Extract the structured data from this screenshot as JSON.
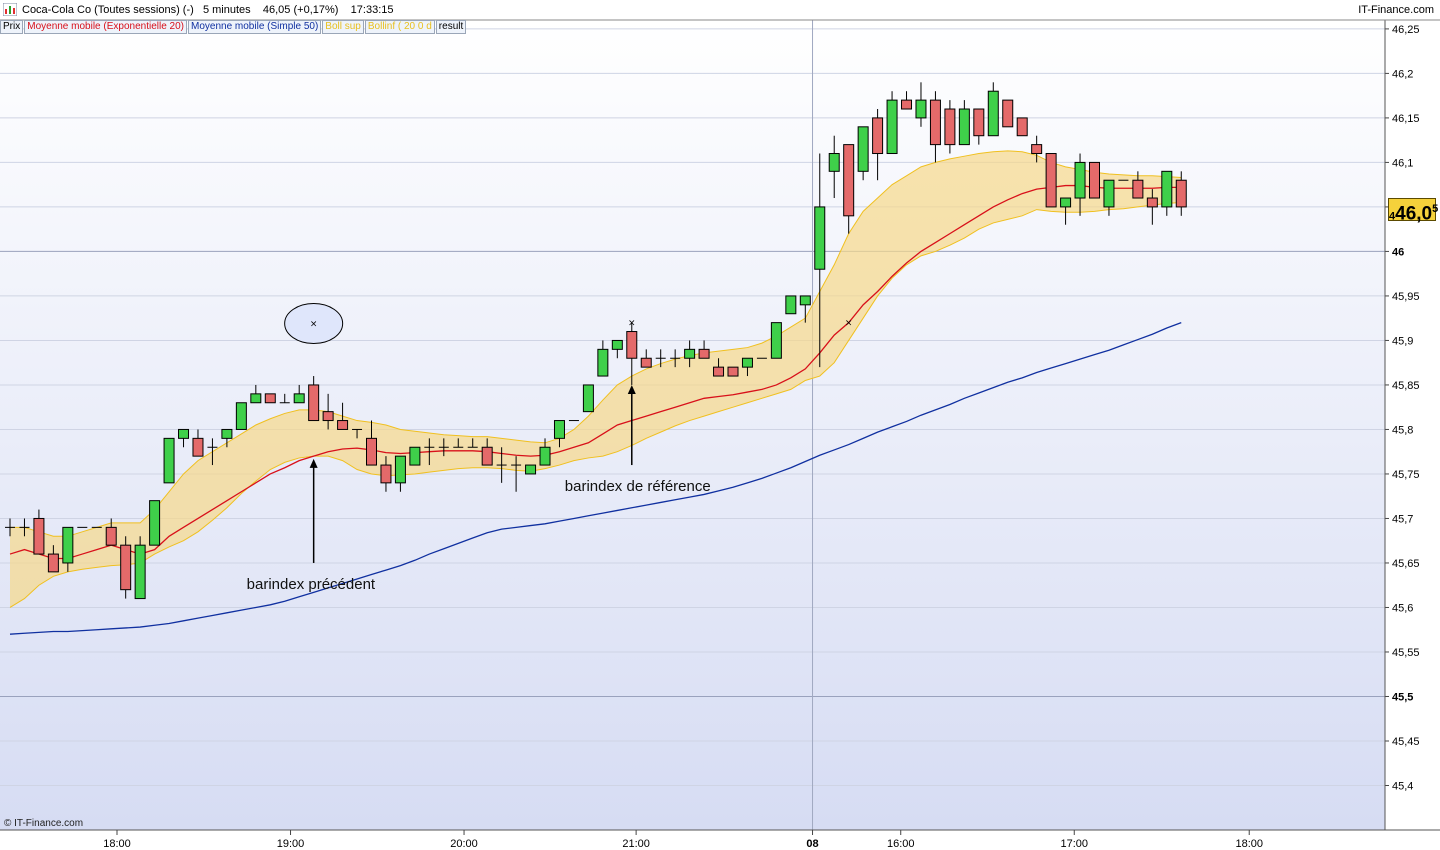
{
  "header": {
    "title": "Coca-Cola Co (Toutes sessions) (-)",
    "interval": "5 minutes",
    "last": "46,05",
    "change": "(+0,17%)",
    "time": "17:33:15",
    "brand": "IT-Finance.com"
  },
  "legend": [
    {
      "label": "Prix",
      "color": "#000000"
    },
    {
      "label": "Moyenne mobile (Exponentielle 20)",
      "color": "#d8101a"
    },
    {
      "label": "Moyenne mobile (Simple 50)",
      "color": "#1030a0"
    },
    {
      "label": "Boll sup",
      "color": "#e8c020"
    },
    {
      "label": "Bollinf ( 20 0 d",
      "color": "#e8c020"
    },
    {
      "label": "result",
      "color": "#000000"
    }
  ],
  "price_badge": {
    "main": "46,0",
    "sup": "5",
    "prefix": "4"
  },
  "footer": "© IT-Finance.com",
  "chart_data": {
    "type": "candlestick",
    "ylim": [
      45.35,
      46.26
    ],
    "y_ticks": [
      "45,4",
      "45,45",
      "45,5",
      "45,55",
      "45,6",
      "45,65",
      "45,7",
      "45,75",
      "45,8",
      "45,85",
      "45,9",
      "45,95",
      "46",
      "46,05",
      "46,1",
      "46,15",
      "46,2",
      "46,25"
    ],
    "y_tick_values": [
      45.4,
      45.45,
      45.5,
      45.55,
      45.6,
      45.65,
      45.7,
      45.75,
      45.8,
      45.85,
      45.9,
      45.95,
      46.0,
      46.05,
      46.1,
      46.15,
      46.2,
      46.25
    ],
    "y_bold_ticks": [
      "45,5",
      "46"
    ],
    "x_ticks": [
      {
        "label": "18:00",
        "bar": 7.4
      },
      {
        "label": "19:00",
        "bar": 19.4
      },
      {
        "label": "20:00",
        "bar": 31.4
      },
      {
        "label": "21:00",
        "bar": 43.3
      },
      {
        "label": "08",
        "bar": 55.5,
        "bold": true
      },
      {
        "label": "16:00",
        "bar": 61.6
      },
      {
        "label": "17:00",
        "bar": 73.6
      },
      {
        "label": "18:00",
        "bar": 85.7
      }
    ],
    "session_break_bar": 55.5,
    "bars": [
      {
        "o": 45.69,
        "h": 45.7,
        "l": 45.68,
        "c": 45.69
      },
      {
        "o": 45.69,
        "h": 45.7,
        "l": 45.68,
        "c": 45.69
      },
      {
        "o": 45.7,
        "h": 45.71,
        "l": 45.66,
        "c": 45.66
      },
      {
        "o": 45.66,
        "h": 45.67,
        "l": 45.64,
        "c": 45.64
      },
      {
        "o": 45.65,
        "h": 45.69,
        "l": 45.64,
        "c": 45.69
      },
      {
        "o": 45.69,
        "h": 45.69,
        "l": 45.69,
        "c": 45.69
      },
      {
        "o": 45.69,
        "h": 45.69,
        "l": 45.69,
        "c": 45.69
      },
      {
        "o": 45.69,
        "h": 45.7,
        "l": 45.67,
        "c": 45.67
      },
      {
        "o": 45.67,
        "h": 45.68,
        "l": 45.61,
        "c": 45.62
      },
      {
        "o": 45.61,
        "h": 45.68,
        "l": 45.61,
        "c": 45.67
      },
      {
        "o": 45.67,
        "h": 45.72,
        "l": 45.67,
        "c": 45.72
      },
      {
        "o": 45.74,
        "h": 45.79,
        "l": 45.74,
        "c": 45.79
      },
      {
        "o": 45.79,
        "h": 45.8,
        "l": 45.78,
        "c": 45.8
      },
      {
        "o": 45.79,
        "h": 45.8,
        "l": 45.77,
        "c": 45.77
      },
      {
        "o": 45.78,
        "h": 45.79,
        "l": 45.76,
        "c": 45.78
      },
      {
        "o": 45.79,
        "h": 45.8,
        "l": 45.78,
        "c": 45.8
      },
      {
        "o": 45.8,
        "h": 45.83,
        "l": 45.8,
        "c": 45.83
      },
      {
        "o": 45.83,
        "h": 45.85,
        "l": 45.83,
        "c": 45.84
      },
      {
        "o": 45.84,
        "h": 45.84,
        "l": 45.83,
        "c": 45.83
      },
      {
        "o": 45.83,
        "h": 45.84,
        "l": 45.83,
        "c": 45.83
      },
      {
        "o": 45.83,
        "h": 45.85,
        "l": 45.83,
        "c": 45.84
      },
      {
        "o": 45.85,
        "h": 45.86,
        "l": 45.81,
        "c": 45.81
      },
      {
        "o": 45.82,
        "h": 45.84,
        "l": 45.8,
        "c": 45.81
      },
      {
        "o": 45.81,
        "h": 45.83,
        "l": 45.8,
        "c": 45.8
      },
      {
        "o": 45.8,
        "h": 45.8,
        "l": 45.79,
        "c": 45.8
      },
      {
        "o": 45.79,
        "h": 45.81,
        "l": 45.76,
        "c": 45.76
      },
      {
        "o": 45.76,
        "h": 45.77,
        "l": 45.73,
        "c": 45.74
      },
      {
        "o": 45.74,
        "h": 45.77,
        "l": 45.73,
        "c": 45.77
      },
      {
        "o": 45.76,
        "h": 45.78,
        "l": 45.76,
        "c": 45.78
      },
      {
        "o": 45.78,
        "h": 45.79,
        "l": 45.76,
        "c": 45.78
      },
      {
        "o": 45.78,
        "h": 45.79,
        "l": 45.77,
        "c": 45.78
      },
      {
        "o": 45.78,
        "h": 45.79,
        "l": 45.78,
        "c": 45.78
      },
      {
        "o": 45.78,
        "h": 45.79,
        "l": 45.78,
        "c": 45.78
      },
      {
        "o": 45.78,
        "h": 45.79,
        "l": 45.77,
        "c": 45.76
      },
      {
        "o": 45.76,
        "h": 45.78,
        "l": 45.74,
        "c": 45.76
      },
      {
        "o": 45.76,
        "h": 45.77,
        "l": 45.73,
        "c": 45.76
      },
      {
        "o": 45.75,
        "h": 45.76,
        "l": 45.75,
        "c": 45.76
      },
      {
        "o": 45.76,
        "h": 45.79,
        "l": 45.76,
        "c": 45.78
      },
      {
        "o": 45.79,
        "h": 45.81,
        "l": 45.78,
        "c": 45.81
      },
      {
        "o": 45.81,
        "h": 45.81,
        "l": 45.81,
        "c": 45.81
      },
      {
        "o": 45.82,
        "h": 45.85,
        "l": 45.82,
        "c": 45.85
      },
      {
        "o": 45.86,
        "h": 45.9,
        "l": 45.86,
        "c": 45.89
      },
      {
        "o": 45.89,
        "h": 45.9,
        "l": 45.88,
        "c": 45.9
      },
      {
        "o": 45.91,
        "h": 45.92,
        "l": 45.85,
        "c": 45.88
      },
      {
        "o": 45.88,
        "h": 45.89,
        "l": 45.87,
        "c": 45.87
      },
      {
        "o": 45.88,
        "h": 45.89,
        "l": 45.87,
        "c": 45.88
      },
      {
        "o": 45.88,
        "h": 45.89,
        "l": 45.87,
        "c": 45.88
      },
      {
        "o": 45.88,
        "h": 45.9,
        "l": 45.87,
        "c": 45.89
      },
      {
        "o": 45.89,
        "h": 45.9,
        "l": 45.88,
        "c": 45.88
      },
      {
        "o": 45.87,
        "h": 45.88,
        "l": 45.86,
        "c": 45.86
      },
      {
        "o": 45.87,
        "h": 45.87,
        "l": 45.86,
        "c": 45.86
      },
      {
        "o": 45.87,
        "h": 45.88,
        "l": 45.86,
        "c": 45.88
      },
      {
        "o": 45.88,
        "h": 45.88,
        "l": 45.88,
        "c": 45.88
      },
      {
        "o": 45.88,
        "h": 45.92,
        "l": 45.88,
        "c": 45.92
      },
      {
        "o": 45.93,
        "h": 45.95,
        "l": 45.93,
        "c": 45.95
      },
      {
        "o": 45.94,
        "h": 45.95,
        "l": 45.92,
        "c": 45.95
      },
      {
        "o": 45.98,
        "h": 46.11,
        "l": 45.87,
        "c": 46.05
      },
      {
        "o": 46.09,
        "h": 46.13,
        "l": 46.06,
        "c": 46.11
      },
      {
        "o": 46.12,
        "h": 46.12,
        "l": 46.02,
        "c": 46.04
      },
      {
        "o": 46.09,
        "h": 46.14,
        "l": 46.08,
        "c": 46.14
      },
      {
        "o": 46.15,
        "h": 46.16,
        "l": 46.08,
        "c": 46.11
      },
      {
        "o": 46.11,
        "h": 46.18,
        "l": 46.11,
        "c": 46.17
      },
      {
        "o": 46.17,
        "h": 46.18,
        "l": 46.16,
        "c": 46.16
      },
      {
        "o": 46.15,
        "h": 46.19,
        "l": 46.14,
        "c": 46.17
      },
      {
        "o": 46.17,
        "h": 46.18,
        "l": 46.1,
        "c": 46.12
      },
      {
        "o": 46.16,
        "h": 46.17,
        "l": 46.11,
        "c": 46.12
      },
      {
        "o": 46.12,
        "h": 46.17,
        "l": 46.12,
        "c": 46.16
      },
      {
        "o": 46.16,
        "h": 46.16,
        "l": 46.12,
        "c": 46.13
      },
      {
        "o": 46.13,
        "h": 46.19,
        "l": 46.13,
        "c": 46.18
      },
      {
        "o": 46.17,
        "h": 46.17,
        "l": 46.14,
        "c": 46.14
      },
      {
        "o": 46.15,
        "h": 46.15,
        "l": 46.14,
        "c": 46.13
      },
      {
        "o": 46.12,
        "h": 46.13,
        "l": 46.1,
        "c": 46.11
      },
      {
        "o": 46.11,
        "h": 46.11,
        "l": 46.05,
        "c": 46.05
      },
      {
        "o": 46.05,
        "h": 46.06,
        "l": 46.03,
        "c": 46.06
      },
      {
        "o": 46.06,
        "h": 46.11,
        "l": 46.04,
        "c": 46.1
      },
      {
        "o": 46.1,
        "h": 46.1,
        "l": 46.06,
        "c": 46.06
      },
      {
        "o": 46.05,
        "h": 46.08,
        "l": 46.04,
        "c": 46.08
      },
      {
        "o": 46.08,
        "h": 46.08,
        "l": 46.08,
        "c": 46.08
      },
      {
        "o": 46.08,
        "h": 46.09,
        "l": 46.06,
        "c": 46.06
      },
      {
        "o": 46.06,
        "h": 46.07,
        "l": 46.03,
        "c": 46.05
      },
      {
        "o": 46.05,
        "h": 46.09,
        "l": 46.04,
        "c": 46.09
      },
      {
        "o": 46.08,
        "h": 46.09,
        "l": 46.04,
        "c": 46.05
      }
    ],
    "ema20": [
      45.66,
      45.665,
      45.66,
      45.655,
      45.655,
      45.66,
      45.665,
      45.67,
      45.665,
      45.66,
      45.665,
      45.68,
      45.69,
      45.7,
      45.71,
      45.72,
      45.73,
      45.74,
      45.75,
      45.757,
      45.765,
      45.77,
      45.775,
      45.778,
      45.779,
      45.777,
      45.774,
      45.773,
      45.774,
      45.775,
      45.776,
      45.776,
      45.776,
      45.775,
      45.773,
      45.771,
      45.77,
      45.771,
      45.775,
      45.78,
      45.785,
      45.795,
      45.805,
      45.81,
      45.815,
      45.82,
      45.825,
      45.83,
      45.835,
      45.837,
      45.839,
      45.842,
      45.845,
      45.85,
      45.858,
      45.868,
      45.886,
      45.906,
      45.92,
      45.94,
      45.955,
      45.972,
      45.987,
      46,
      46.01,
      46.02,
      46.03,
      46.04,
      46.05,
      46.058,
      46.065,
      46.07,
      46.072,
      46.074,
      46.074,
      46.072,
      46.071,
      46.071,
      46.071,
      46.071,
      46.072,
      46.072
    ],
    "boll_up": [
      45.69,
      45.69,
      45.685,
      45.68,
      45.68,
      45.685,
      45.69,
      45.695,
      45.695,
      45.695,
      45.71,
      45.73,
      45.75,
      45.765,
      45.775,
      45.785,
      45.795,
      45.805,
      45.812,
      45.818,
      45.822,
      45.822,
      45.82,
      45.815,
      45.81,
      45.808,
      45.805,
      45.8,
      45.798,
      45.796,
      45.794,
      45.793,
      45.792,
      45.792,
      45.79,
      45.788,
      45.786,
      45.785,
      45.79,
      45.8,
      45.815,
      45.833,
      45.85,
      45.86,
      45.868,
      45.874,
      45.879,
      45.883,
      45.886,
      45.888,
      45.89,
      45.892,
      45.897,
      45.905,
      45.915,
      45.925,
      45.955,
      45.985,
      46.02,
      46.045,
      46.06,
      46.075,
      46.085,
      46.095,
      46.1,
      46.104,
      46.107,
      46.11,
      46.112,
      46.113,
      46.112,
      46.108,
      46.1,
      46.095,
      46.092,
      46.089,
      46.087,
      46.086,
      46.085,
      46.085,
      46.084,
      46.083
    ],
    "boll_low": [
      45.6,
      45.61,
      45.625,
      45.635,
      45.64,
      45.643,
      45.645,
      45.647,
      45.648,
      45.65,
      45.66,
      45.668,
      45.675,
      45.685,
      45.698,
      45.712,
      45.728,
      45.742,
      45.755,
      45.763,
      45.768,
      45.77,
      45.77,
      45.765,
      45.755,
      45.75,
      45.748,
      45.749,
      45.75,
      45.752,
      45.754,
      45.756,
      45.757,
      45.757,
      45.756,
      45.754,
      45.753,
      45.756,
      45.76,
      45.765,
      45.768,
      45.77,
      45.775,
      45.782,
      45.79,
      45.797,
      45.804,
      45.81,
      45.815,
      45.82,
      45.825,
      45.83,
      45.835,
      45.84,
      45.845,
      45.855,
      45.86,
      45.875,
      45.9,
      45.925,
      45.95,
      45.97,
      45.985,
      45.995,
      46,
      46.007,
      46.015,
      46.025,
      46.032,
      46.036,
      46.04,
      46.047,
      46.045,
      46.044,
      46.044,
      46.045,
      46.047,
      46.048,
      46.05,
      46.052,
      46.054,
      46.055
    ],
    "sma50": [
      45.57,
      45.571,
      45.572,
      45.573,
      45.573,
      45.574,
      45.575,
      45.576,
      45.577,
      45.578,
      45.58,
      45.582,
      45.585,
      45.588,
      45.591,
      45.594,
      45.597,
      45.6,
      45.603,
      45.607,
      45.612,
      45.617,
      45.622,
      45.627,
      45.632,
      45.637,
      45.642,
      45.647,
      45.653,
      45.66,
      45.666,
      45.672,
      45.678,
      45.684,
      45.688,
      45.69,
      45.692,
      45.694,
      45.697,
      45.7,
      45.703,
      45.706,
      45.709,
      45.712,
      45.715,
      45.718,
      45.721,
      45.724,
      45.727,
      45.731,
      45.735,
      45.74,
      45.745,
      45.751,
      45.757,
      45.764,
      45.771,
      45.777,
      45.783,
      45.79,
      45.797,
      45.803,
      45.809,
      45.816,
      45.822,
      45.828,
      45.835,
      45.841,
      45.847,
      45.853,
      45.858,
      45.864,
      45.869,
      45.874,
      45.879,
      45.884,
      45.889,
      45.895,
      45.901,
      45.907,
      45.914,
      45.92
    ],
    "signal_crosses": [
      {
        "bar": 43,
        "value": 45.92
      },
      {
        "bar": 58,
        "value": 45.92
      }
    ],
    "annotations": [
      {
        "text": "barindex précédent",
        "bar": 21,
        "arrow_from": 45.65,
        "arrow_to": 45.767
      },
      {
        "text": "barindex de référence",
        "bar": 43,
        "arrow_from": 45.76,
        "arrow_to": 45.85
      }
    ],
    "marker_ellipse": {
      "bar": 21,
      "value": 45.919
    }
  }
}
